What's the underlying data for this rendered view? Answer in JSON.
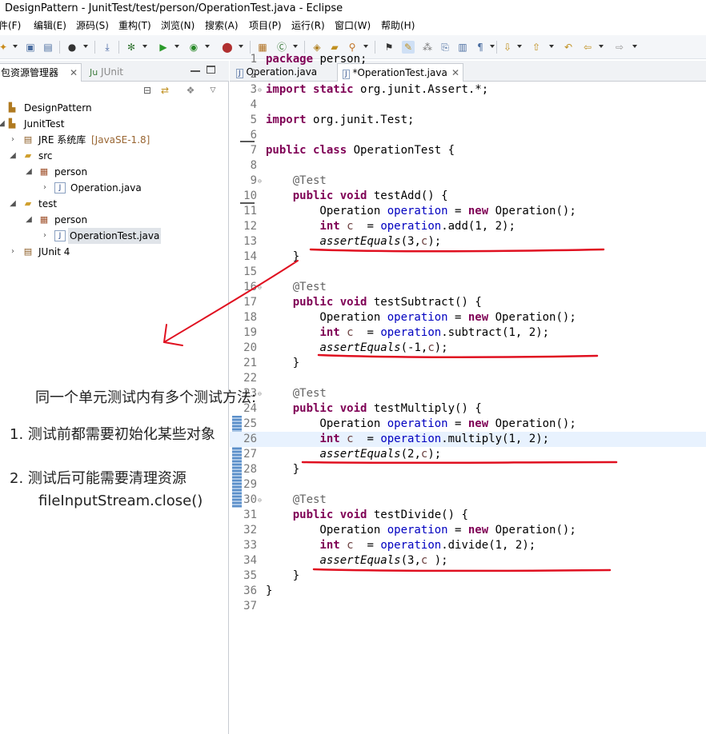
{
  "window": {
    "title": "DesignPattern - JunitTest/test/person/OperationTest.java - Eclipse"
  },
  "menu": [
    "件(F)",
    "编辑(E)",
    "源码(S)",
    "重构(T)",
    "浏览(N)",
    "搜索(A)",
    "项目(P)",
    "运行(R)",
    "窗口(W)",
    "帮助(H)"
  ],
  "left_panel": {
    "tabs": [
      {
        "label": "包资源管理器",
        "icon": "package-explorer-icon",
        "active": true
      },
      {
        "label": "JUnit",
        "icon": "junit-icon",
        "active": false
      }
    ],
    "tree": [
      {
        "label": "DesignPattern",
        "icon": "project-icon",
        "twisty": ""
      },
      {
        "label": "JunitTest",
        "icon": "project-icon",
        "twisty": "expanded"
      },
      {
        "label": "JRE 系统库",
        "decoration": "[JavaSE-1.8]",
        "icon": "library-icon",
        "twisty": "collapsed"
      },
      {
        "label": "src",
        "icon": "source-folder-icon",
        "twisty": "expanded"
      },
      {
        "label": "person",
        "icon": "package-icon",
        "twisty": "expanded"
      },
      {
        "label": "Operation.java",
        "icon": "java-file-icon",
        "twisty": "collapsed"
      },
      {
        "label": "test",
        "icon": "source-folder-icon",
        "twisty": "expanded"
      },
      {
        "label": "person",
        "icon": "package-icon",
        "twisty": "expanded"
      },
      {
        "label": "OperationTest.java",
        "icon": "java-file-icon",
        "twisty": "collapsed",
        "selected": true
      },
      {
        "label": "JUnit 4",
        "icon": "library-icon",
        "twisty": "collapsed"
      }
    ]
  },
  "editor": {
    "tabs": [
      {
        "label": "Operation.java",
        "icon": "java-file-icon",
        "active": false
      },
      {
        "label": "*OperationTest.java",
        "icon": "java-file-icon",
        "active": true
      }
    ],
    "current_line": 26,
    "lines": [
      {
        "n": "1",
        "text": "package person;"
      },
      {
        "n": "2",
        "text": ""
      },
      {
        "n": "3",
        "text": "import static org.junit.Assert.*;"
      },
      {
        "n": "4",
        "text": ""
      },
      {
        "n": "5",
        "text": "import org.junit.Test;"
      },
      {
        "n": "6",
        "text": ""
      },
      {
        "n": "7",
        "text": "public class OperationTest {"
      },
      {
        "n": "8",
        "text": ""
      },
      {
        "n": "9",
        "text": "    @Test"
      },
      {
        "n": "10",
        "text": "    public void testAdd() {"
      },
      {
        "n": "11",
        "text": "        Operation operation = new Operation();"
      },
      {
        "n": "12",
        "text": "        int c  = operation.add(1, 2);"
      },
      {
        "n": "13",
        "text": "        assertEquals(3,c);"
      },
      {
        "n": "14",
        "text": "    }"
      },
      {
        "n": "15",
        "text": ""
      },
      {
        "n": "16",
        "text": "    @Test"
      },
      {
        "n": "17",
        "text": "    public void testSubtract() {"
      },
      {
        "n": "18",
        "text": "        Operation operation = new Operation();"
      },
      {
        "n": "19",
        "text": "        int c  = operation.subtract(1, 2);"
      },
      {
        "n": "20",
        "text": "        assertEquals(-1,c);"
      },
      {
        "n": "21",
        "text": "    }"
      },
      {
        "n": "22",
        "text": ""
      },
      {
        "n": "23",
        "text": "    @Test"
      },
      {
        "n": "24",
        "text": "    public void testMultiply() {"
      },
      {
        "n": "25",
        "text": "        Operation operation = new Operation();"
      },
      {
        "n": "26",
        "text": "        int c  = operation.multiply(1, 2);"
      },
      {
        "n": "27",
        "text": "        assertEquals(2,c);"
      },
      {
        "n": "28",
        "text": "    }"
      },
      {
        "n": "29",
        "text": ""
      },
      {
        "n": "30",
        "text": "    @Test"
      },
      {
        "n": "31",
        "text": "    public void testDivide() {"
      },
      {
        "n": "32",
        "text": "        Operation operation = new Operation();"
      },
      {
        "n": "33",
        "text": "        int c  = operation.divide(1, 2);"
      },
      {
        "n": "34",
        "text": "        assertEquals(3,c );"
      },
      {
        "n": "35",
        "text": "    }"
      },
      {
        "n": "36",
        "text": "}"
      },
      {
        "n": "37",
        "text": ""
      }
    ]
  },
  "annotation": {
    "heading": "同一个单元测试内有多个测试方法:",
    "point1": "1. 测试前都需要初始化某些对象",
    "point2": "2. 测试后可能需要清理资源",
    "point2_detail": "fileInputStream.close()",
    "mark_color": "#e01020"
  }
}
